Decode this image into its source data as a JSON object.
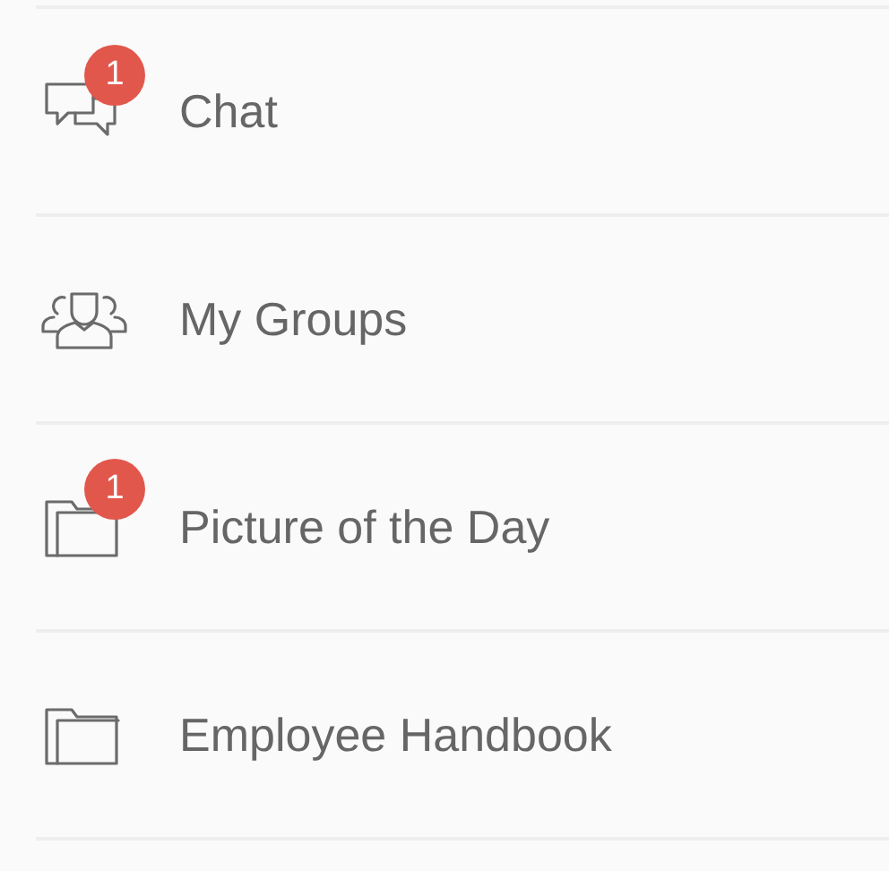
{
  "menu_items": [
    {
      "kind": "chat",
      "label": "Chat",
      "badge": "1"
    },
    {
      "kind": "group",
      "label": "My Groups"
    },
    {
      "kind": "folder",
      "label": "Picture of the Day",
      "badge": "1"
    },
    {
      "kind": "folder",
      "label": "Employee Handbook"
    }
  ]
}
